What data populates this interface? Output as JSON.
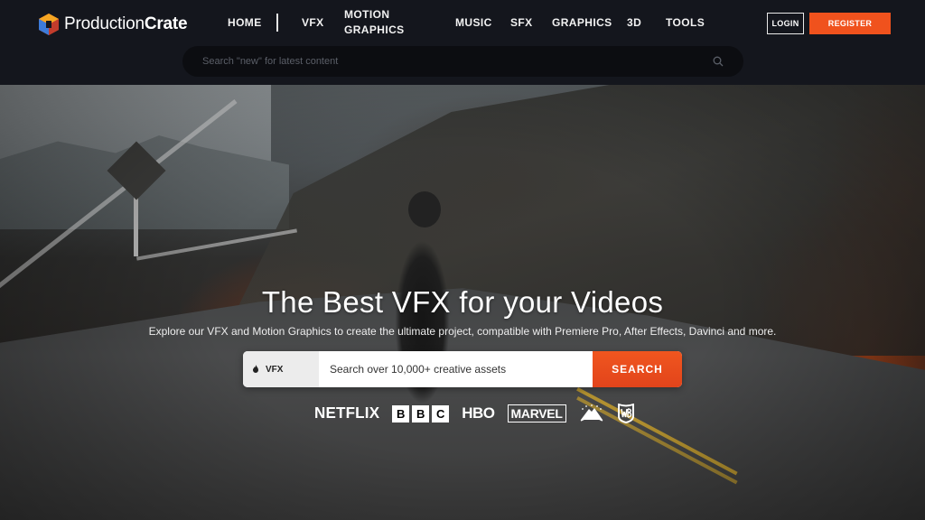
{
  "header": {
    "logo": {
      "text_left": "Production",
      "text_right": "Crate"
    },
    "nav": {
      "home": "HOME",
      "vfx": "VFX",
      "motion_graphics_line1": "MOTION",
      "motion_graphics_line2": "GRAPHICS",
      "music": "MUSIC",
      "sfx": "SFX",
      "graphics": "GRAPHICS",
      "three_d": "3D",
      "tools": "TOOLS"
    },
    "login_label": "LOGIN",
    "register_label": "REGISTER",
    "search_placeholder": "Search \"new\" for latest content",
    "search_icon": "search-icon"
  },
  "hero": {
    "title": "The Best VFX for your Videos",
    "subtitle": "Explore our VFX and Motion Graphics to create the ultimate project, compatible with Premiere Pro, After Effects, Davinci and more.",
    "search": {
      "category": "VFX",
      "category_icon": "flame-icon",
      "placeholder": "Search over 10,000+ creative assets",
      "button_label": "SEARCH"
    },
    "brands": {
      "netflix": "NETFLIX",
      "bbc": [
        "B",
        "B",
        "C"
      ],
      "hbo": "HBO",
      "marvel": "MARVEL",
      "paramount_icon": "paramount-logo",
      "wb_icon": "warner-bros-logo"
    }
  },
  "colors": {
    "accent": "#f0521d",
    "header_bg": "#14161d",
    "search_bg": "#0c0d11"
  }
}
